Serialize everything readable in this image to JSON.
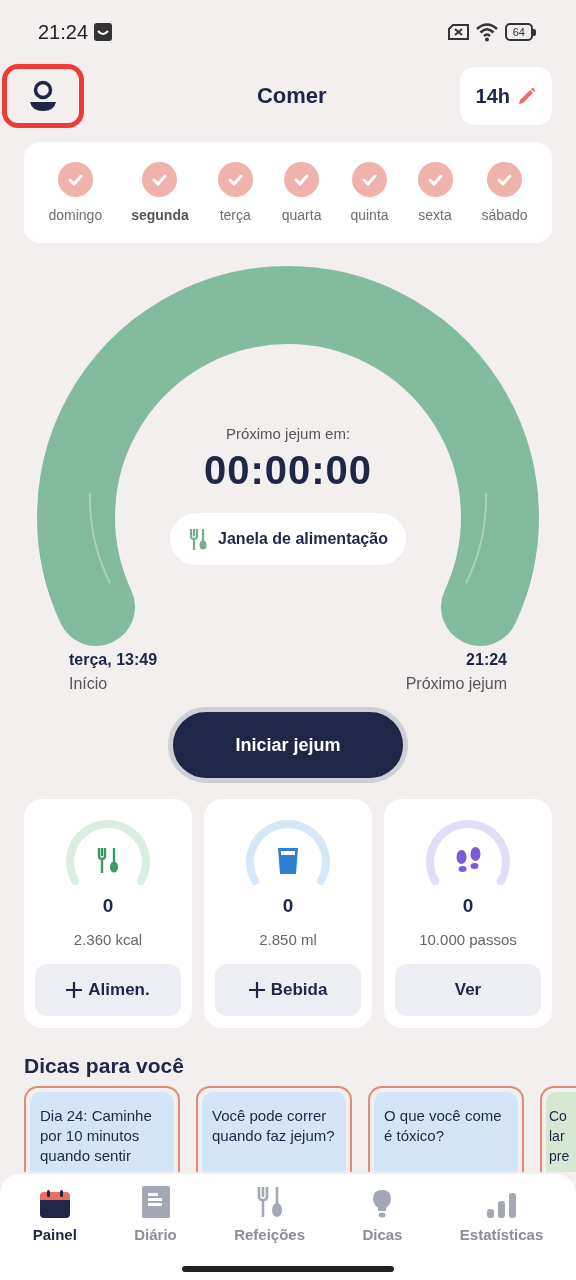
{
  "status_bar": {
    "time": "21:24",
    "battery": "64"
  },
  "header": {
    "title": "Comer",
    "fasting_hours": "14h"
  },
  "week": [
    {
      "label": "domingo",
      "checked": true,
      "today": false
    },
    {
      "label": "segunda",
      "checked": true,
      "today": true
    },
    {
      "label": "terça",
      "checked": true,
      "today": false
    },
    {
      "label": "quarta",
      "checked": true,
      "today": false
    },
    {
      "label": "quinta",
      "checked": true,
      "today": false
    },
    {
      "label": "sexta",
      "checked": true,
      "today": false
    },
    {
      "label": "sábado",
      "checked": true,
      "today": false
    }
  ],
  "timer": {
    "caption": "Próximo jejum em:",
    "countdown": "00:00:00",
    "window_label": "Janela de alimentação"
  },
  "start": {
    "time": "terça, 13:49",
    "label": "Início"
  },
  "end": {
    "time": "21:24",
    "label": "Próximo jejum"
  },
  "action_button": "Iniciar jejum",
  "trackers": [
    {
      "kind": "food",
      "value": "0",
      "goal": "2.360 kcal",
      "button": "Alimen.",
      "plus": true
    },
    {
      "kind": "drink",
      "value": "0",
      "goal": "2.850 ml",
      "button": "Bebida",
      "plus": true
    },
    {
      "kind": "steps",
      "value": "0",
      "goal": "10.000 passos",
      "button": "Ver",
      "plus": false
    }
  ],
  "tips": {
    "title": "Dicas para você",
    "items": [
      {
        "text": "Dia 24: Caminhe por 10 minutos quando sentir",
        "color": "#d3e5f7"
      },
      {
        "text": "Você pode correr quando faz jejum?",
        "color": "#d3e5f7"
      },
      {
        "text": "O que você come é tóxico?",
        "color": "#d3e5f7"
      },
      {
        "text": "Co lar pre",
        "color": "#d6e7d4"
      }
    ]
  },
  "nav": [
    {
      "label": "Painel",
      "kind": "calendar",
      "selected": true
    },
    {
      "label": "Diário",
      "kind": "journal",
      "selected": false
    },
    {
      "label": "Refeições",
      "kind": "meals",
      "selected": false
    },
    {
      "label": "Dicas",
      "kind": "tips",
      "selected": false
    },
    {
      "label": "Estatísticas",
      "kind": "stats",
      "selected": false
    }
  ]
}
